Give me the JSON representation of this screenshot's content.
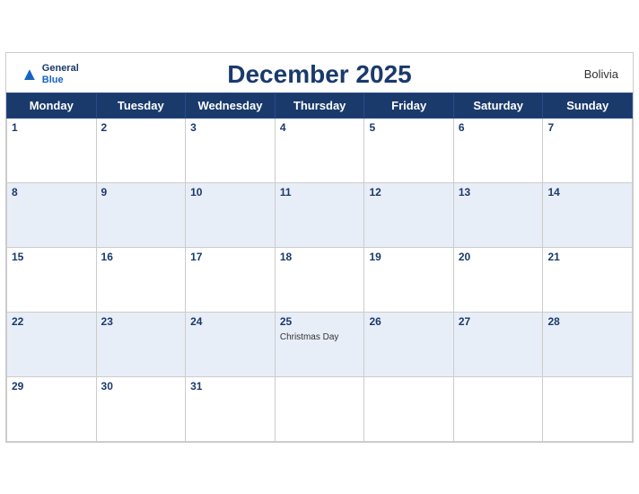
{
  "header": {
    "logo": {
      "general": "General",
      "blue": "Blue",
      "icon_symbol": "▲"
    },
    "title": "December 2025",
    "country": "Bolivia"
  },
  "weekdays": [
    "Monday",
    "Tuesday",
    "Wednesday",
    "Thursday",
    "Friday",
    "Saturday",
    "Sunday"
  ],
  "weeks": [
    [
      {
        "day": "1",
        "event": ""
      },
      {
        "day": "2",
        "event": ""
      },
      {
        "day": "3",
        "event": ""
      },
      {
        "day": "4",
        "event": ""
      },
      {
        "day": "5",
        "event": ""
      },
      {
        "day": "6",
        "event": ""
      },
      {
        "day": "7",
        "event": ""
      }
    ],
    [
      {
        "day": "8",
        "event": ""
      },
      {
        "day": "9",
        "event": ""
      },
      {
        "day": "10",
        "event": ""
      },
      {
        "day": "11",
        "event": ""
      },
      {
        "day": "12",
        "event": ""
      },
      {
        "day": "13",
        "event": ""
      },
      {
        "day": "14",
        "event": ""
      }
    ],
    [
      {
        "day": "15",
        "event": ""
      },
      {
        "day": "16",
        "event": ""
      },
      {
        "day": "17",
        "event": ""
      },
      {
        "day": "18",
        "event": ""
      },
      {
        "day": "19",
        "event": ""
      },
      {
        "day": "20",
        "event": ""
      },
      {
        "day": "21",
        "event": ""
      }
    ],
    [
      {
        "day": "22",
        "event": ""
      },
      {
        "day": "23",
        "event": ""
      },
      {
        "day": "24",
        "event": ""
      },
      {
        "day": "25",
        "event": "Christmas Day"
      },
      {
        "day": "26",
        "event": ""
      },
      {
        "day": "27",
        "event": ""
      },
      {
        "day": "28",
        "event": ""
      }
    ],
    [
      {
        "day": "29",
        "event": ""
      },
      {
        "day": "30",
        "event": ""
      },
      {
        "day": "31",
        "event": ""
      },
      {
        "day": "",
        "event": ""
      },
      {
        "day": "",
        "event": ""
      },
      {
        "day": "",
        "event": ""
      },
      {
        "day": "",
        "event": ""
      }
    ]
  ]
}
